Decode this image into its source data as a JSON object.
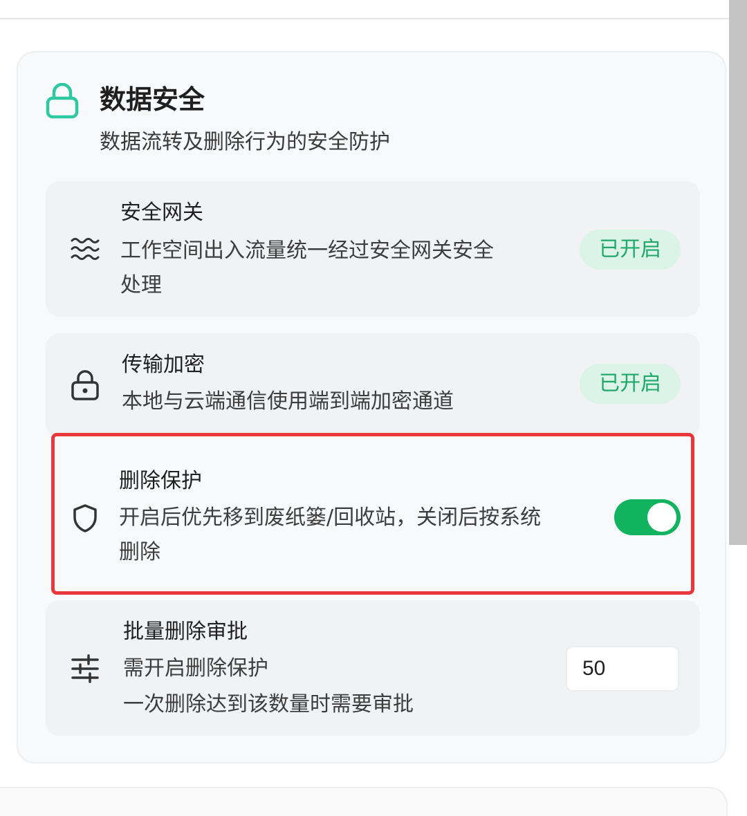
{
  "section": {
    "title": "数据安全",
    "subtitle": "数据流转及删除行为的安全防护",
    "icon": "lock-icon",
    "accent_color": "#2ec9a0"
  },
  "rows": [
    {
      "icon": "waves-icon",
      "title": "安全网关",
      "desc_line1": "工作空间出入流量统一经过安全网关安全",
      "desc_line2": "处理",
      "status": "已开启"
    },
    {
      "icon": "padlock-icon",
      "title": "传输加密",
      "desc_line1": "本地与云端通信使用端到端加密通道",
      "status": "已开启"
    },
    {
      "icon": "shield-icon",
      "title": "删除保护",
      "desc_line1": "开启后优先移到废纸篓/回收站，关闭后按系统",
      "desc_line2": "删除",
      "toggle_on": true,
      "toggle_color": "#11b35f"
    },
    {
      "icon": "sliders-icon",
      "title": "批量删除审批",
      "desc_line1": "需开启删除保护",
      "desc_line2": "一次删除达到该数量时需要审批",
      "input_value": "50"
    }
  ],
  "colors": {
    "badge_bg": "#dcf3e8",
    "badge_text": "#1fa86a",
    "highlight_border": "#e8383d"
  }
}
